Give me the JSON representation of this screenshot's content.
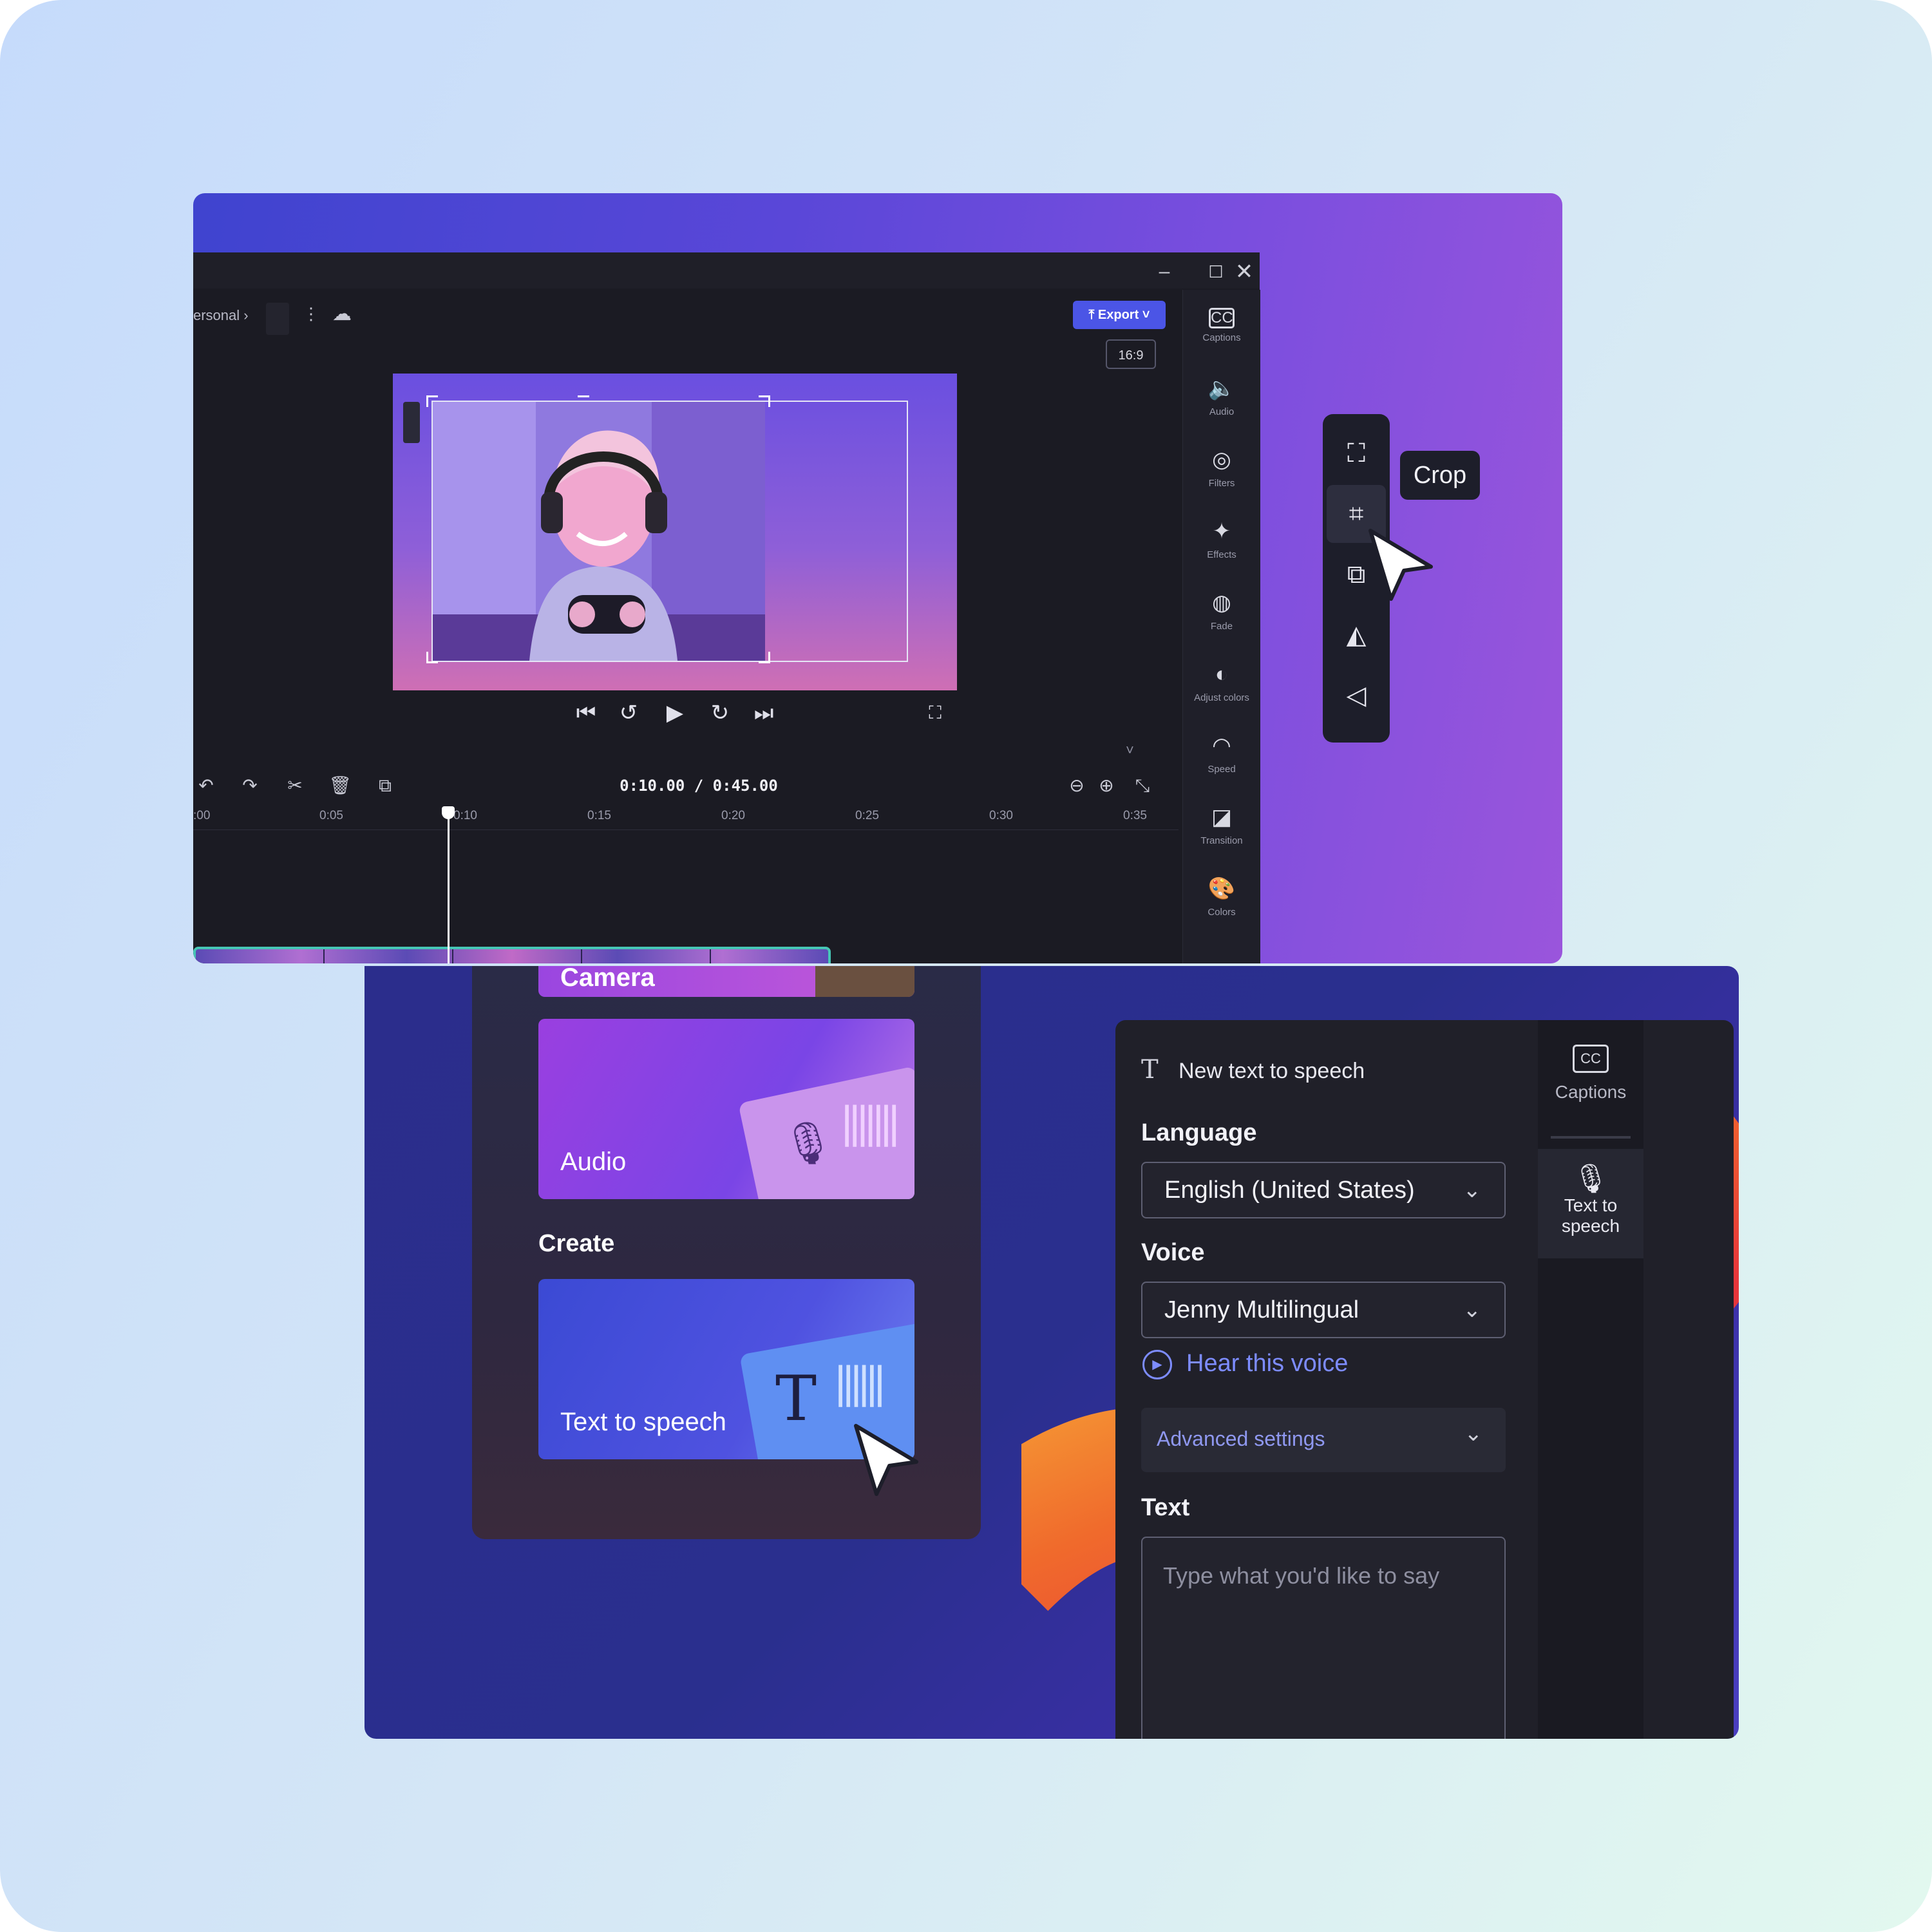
{
  "editor": {
    "breadcrumb": "ersonal",
    "breadcrumb_sep": "›",
    "export_label": "Export",
    "aspect_ratio": "16:9",
    "time_display": "0:10.00 / 0:45.00",
    "ruler_ticks": [
      ":00",
      "0:05",
      "0:10",
      "0:15",
      "0:20",
      "0:25",
      "0:30",
      "0:35"
    ],
    "right_panel": [
      {
        "label": "Captions",
        "icon": "captions-icon"
      },
      {
        "label": "Audio",
        "icon": "audio-icon"
      },
      {
        "label": "Filters",
        "icon": "filters-icon"
      },
      {
        "label": "Effects",
        "icon": "effects-icon"
      },
      {
        "label": "Fade",
        "icon": "fade-icon"
      },
      {
        "label": "Adjust colors",
        "icon": "adjust-colors-icon"
      },
      {
        "label": "Speed",
        "icon": "speed-icon"
      },
      {
        "label": "Transition",
        "icon": "transition-icon"
      },
      {
        "label": "Colors",
        "icon": "colors-icon"
      }
    ],
    "floating_tools": [
      "fit-icon",
      "crop-icon",
      "pip-icon",
      "flip-icon",
      "rotate-icon"
    ],
    "tooltip": "Crop"
  },
  "library": {
    "tile_top_label": "Camera",
    "audio_label": "Audio",
    "section_create": "Create",
    "tts_tile_label": "Text to speech"
  },
  "tts": {
    "header": "New text to speech",
    "language_label": "Language",
    "language_value": "English (United States)",
    "voice_label": "Voice",
    "voice_value": "Jenny Multilingual",
    "hear_voice": "Hear this voice",
    "advanced": "Advanced settings",
    "text_label": "Text",
    "text_placeholder": "Type what you'd like to say",
    "side_captions": "Captions",
    "side_tts_line1": "Text to",
    "side_tts_line2": "speech"
  },
  "colors": {
    "accent": "#4b55e6",
    "link": "#7d8cff",
    "timeline_border": "#46c6b5"
  }
}
